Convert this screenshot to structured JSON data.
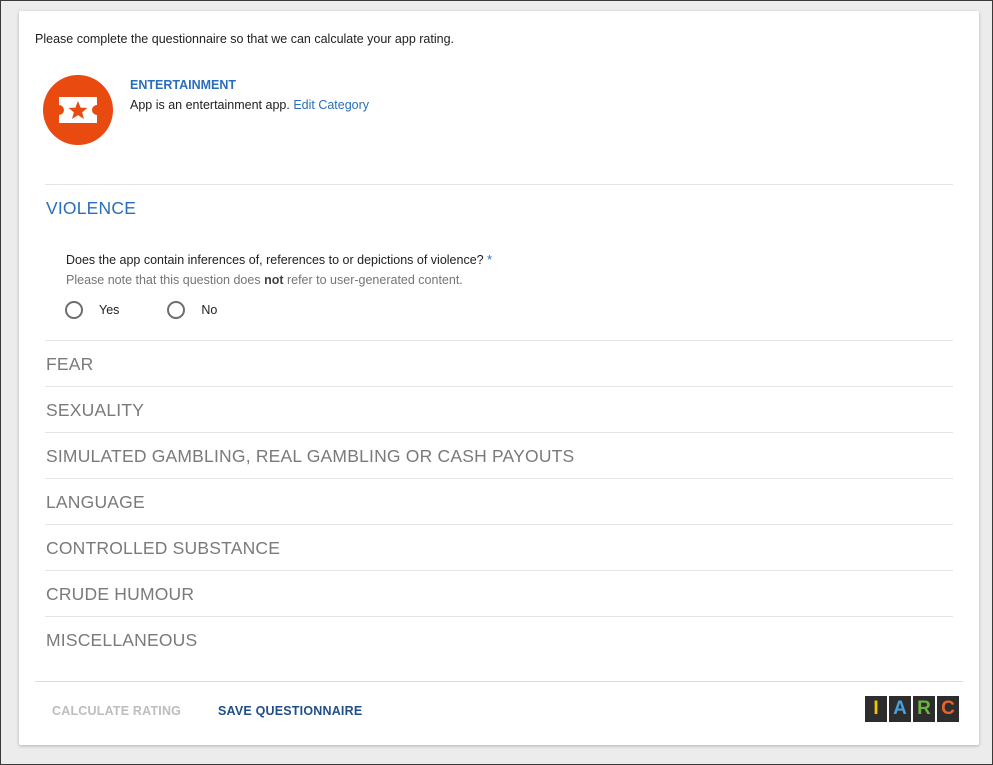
{
  "intro_text": "Please complete the questionnaire so that we can calculate your app rating.",
  "category": {
    "icon": "ticket-star-icon",
    "icon_color": "#e84a0f",
    "title": "ENTERTAINMENT",
    "description": "App is an entertainment app.",
    "edit_link": "Edit Category"
  },
  "active_section": {
    "title": "VIOLENCE",
    "question": "Does the app contain inferences of, references to or depictions of violence?",
    "required_mark": "*",
    "note_prefix": "Please note that this question does ",
    "note_bold": "not",
    "note_suffix": " refer to user-generated content.",
    "options": [
      "Yes",
      "No"
    ]
  },
  "sections": [
    "FEAR",
    "SEXUALITY",
    "SIMULATED GAMBLING, REAL GAMBLING OR CASH PAYOUTS",
    "LANGUAGE",
    "CONTROLLED SUBSTANCE",
    "CRUDE HUMOUR",
    "MISCELLANEOUS"
  ],
  "footer": {
    "calculate_label": "CALCULATE RATING",
    "save_label": "SAVE QUESTIONNAIRE"
  },
  "iarc_logo": {
    "letters": [
      "I",
      "A",
      "R",
      "C"
    ],
    "colors": [
      "#f5c400",
      "#4a9fdc",
      "#6cb33f",
      "#e8632b"
    ]
  },
  "colors": {
    "accent": "#2a6ebb",
    "save_button": "#1f4f8a",
    "disabled": "#bdbdbd"
  }
}
